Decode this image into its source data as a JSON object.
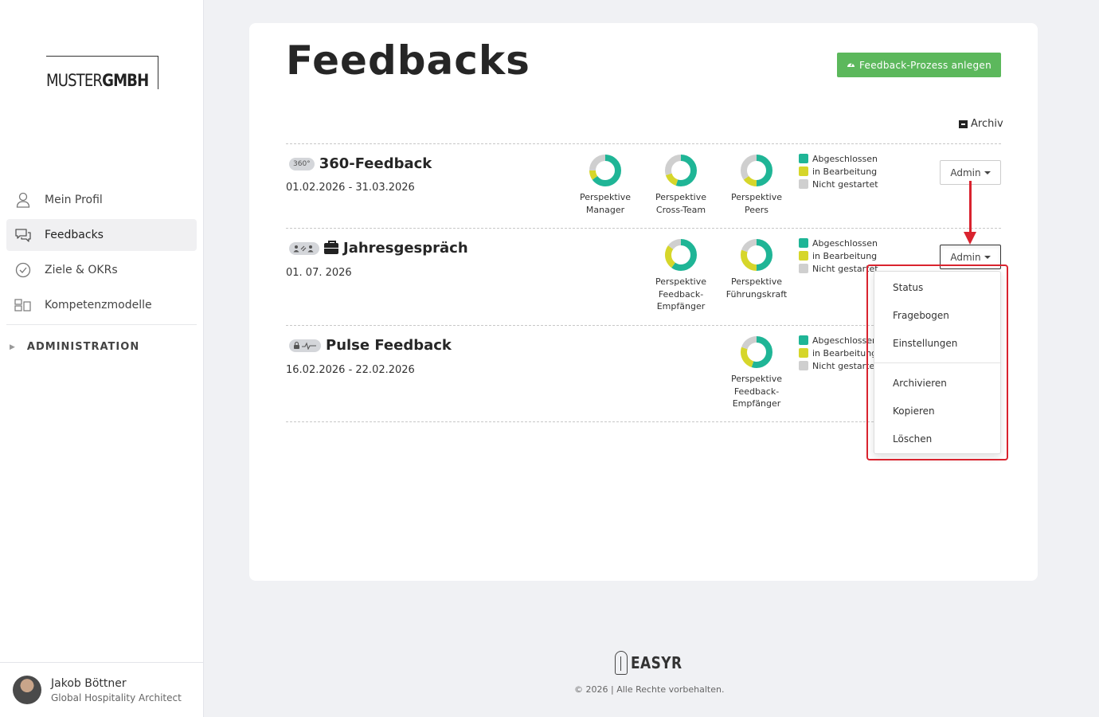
{
  "company_logo": {
    "light": "MUSTER",
    "bold": "GMBH"
  },
  "sidebar": {
    "items": [
      {
        "label": "Mein Profil",
        "icon": "user-icon"
      },
      {
        "label": "Feedbacks",
        "icon": "chat-bubbles-icon"
      },
      {
        "label": "Ziele & OKRs",
        "icon": "check-circle-icon"
      },
      {
        "label": "Kompetenzmodelle",
        "icon": "grid-icon"
      }
    ],
    "admin_section": "ADMINISTRATION"
  },
  "user": {
    "name": "Jakob Böttner",
    "role": "Global Hospitality Architect"
  },
  "page": {
    "title": "Feedbacks",
    "create_button": "Feedback-Prozess anlegen",
    "archive_link": "Archiv"
  },
  "legend": {
    "done": "Abgeschlossen",
    "in_progress": "in Bearbeitung",
    "not_started": "Nicht gestartet"
  },
  "colors": {
    "done": "#1fb596",
    "in_progress": "#d6d62a",
    "not_started": "#cfcfcf",
    "primary": "#5cb85c",
    "highlight": "#d9232e"
  },
  "processes": [
    {
      "title": "360-Feedback",
      "badge": "360°",
      "date": "01.02.2026 - 31.03.2026",
      "admin_label": "Admin",
      "perspectives": [
        {
          "label_lines": [
            "Perspektive",
            "Manager"
          ],
          "done": 0.65,
          "in_progress": 0.1,
          "not_started": 0.25
        },
        {
          "label_lines": [
            "Perspektive",
            "Cross-Team"
          ],
          "done": 0.55,
          "in_progress": 0.15,
          "not_started": 0.3
        },
        {
          "label_lines": [
            "Perspektive",
            "Peers"
          ],
          "done": 0.5,
          "in_progress": 0.15,
          "not_started": 0.35
        }
      ]
    },
    {
      "title": "Jahresgespräch",
      "date": "01. 07. 2026",
      "admin_label": "Admin",
      "perspectives": [
        {
          "label_lines": [
            "Perspektive",
            "Feedback-",
            "Empfänger"
          ],
          "done": 0.6,
          "in_progress": 0.25,
          "not_started": 0.15
        },
        {
          "label_lines": [
            "Perspektive",
            "Führungskraft"
          ],
          "done": 0.5,
          "in_progress": 0.3,
          "not_started": 0.2
        }
      ]
    },
    {
      "title": "Pulse Feedback",
      "date": "16.02.2026 - 22.02.2026",
      "perspectives": [
        {
          "label_lines": [
            "Perspektive",
            "Feedback-",
            "Empfänger"
          ],
          "done": 0.55,
          "in_progress": 0.25,
          "not_started": 0.2
        }
      ]
    }
  ],
  "dropdown": {
    "items": [
      "Status",
      "Fragebogen",
      "Einstellungen",
      "Archivieren",
      "Kopieren",
      "Löschen"
    ]
  },
  "footer": {
    "brand": "EASYR",
    "copyright": "© 2026 | Alle Rechte vorbehalten."
  }
}
